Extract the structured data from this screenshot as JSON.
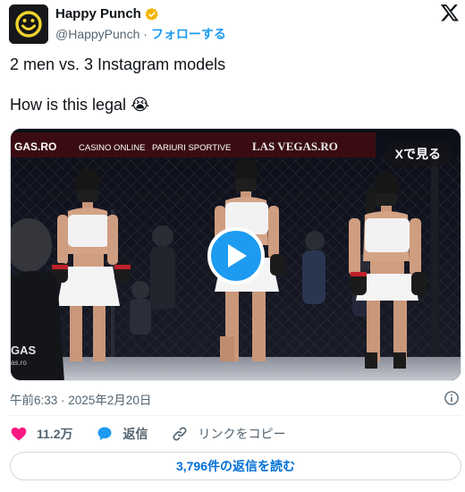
{
  "author": {
    "name": "Happy Punch",
    "handle": "@HappyPunch",
    "separator": "·",
    "follow_label": "フォローする",
    "verified_badge_color": "#f4b400",
    "avatar_icon": "smiley-face-logo"
  },
  "tweet": {
    "line1": "2 men vs. 3 Instagram models",
    "line2_text": "How is this legal",
    "line2_emoji": "😭"
  },
  "media": {
    "view_on_x_label": "Xで見る",
    "banner_text": [
      "GAS.RO",
      "CASINO ONLINE",
      "PARIURI SPORTIVE",
      "LAS VEGAS.RO"
    ],
    "corner_logo": "GAS",
    "corner_logo_sub": "as.ro",
    "play_button_color": "#1d9bf0"
  },
  "meta": {
    "timestamp": "午前6:33 · 2025年2月20日"
  },
  "actions": {
    "like_count": "11.2万",
    "reply_label": "返信",
    "copy_link_label": "リンクをコピー",
    "like_color": "#f91880",
    "reply_color": "#1d9bf0"
  },
  "footer": {
    "read_replies_label": "3,796件の返信を読む"
  }
}
